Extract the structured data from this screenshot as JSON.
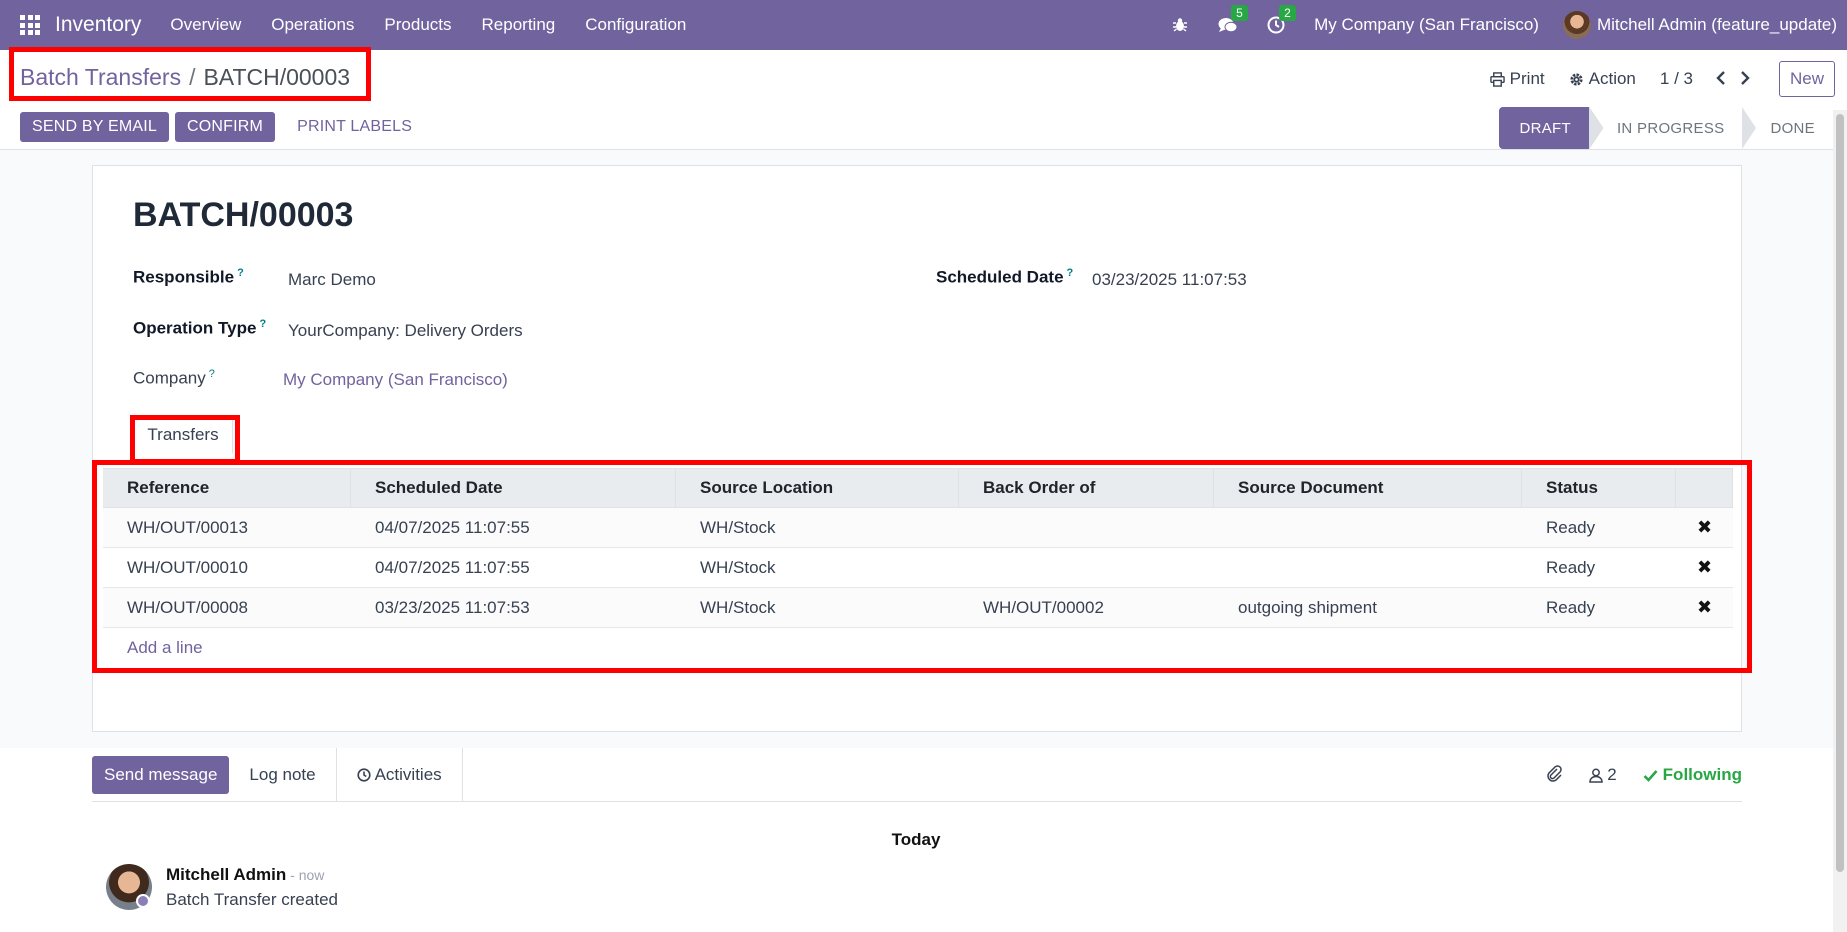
{
  "topnav": {
    "app_name": "Inventory",
    "menu": [
      "Overview",
      "Operations",
      "Products",
      "Reporting",
      "Configuration"
    ],
    "messages_count": "5",
    "activities_count": "2",
    "company": "My Company (San Francisco)",
    "user": "Mitchell Admin (feature_update)"
  },
  "breadcrumb": {
    "parent": "Batch Transfers",
    "separator": "/",
    "current": "BATCH/00003"
  },
  "control": {
    "print_label": "Print",
    "action_label": "Action",
    "pager": "1 / 3",
    "new_label": "New"
  },
  "actions": {
    "send_email": "SEND BY EMAIL",
    "confirm": "CONFIRM",
    "print_labels": "PRINT LABELS"
  },
  "statusbar": [
    "DRAFT",
    "IN PROGRESS",
    "DONE"
  ],
  "form": {
    "title": "BATCH/00003",
    "responsible_label": "Responsible",
    "responsible_value": "Marc Demo",
    "scheduled_label": "Scheduled Date",
    "scheduled_value": "03/23/2025 11:07:53",
    "optype_label": "Operation Type",
    "optype_value": "YourCompany: Delivery Orders",
    "company_label": "Company",
    "company_value": "My Company (San Francisco)",
    "help_mark": "?"
  },
  "tab": "Transfers",
  "table": {
    "headers": [
      "Reference",
      "Scheduled Date",
      "Source Location",
      "Back Order of",
      "Source Document",
      "Status"
    ],
    "rows": [
      {
        "reference": "WH/OUT/00013",
        "date": "04/07/2025 11:07:55",
        "source": "WH/Stock",
        "backorder": "",
        "document": "",
        "status": "Ready"
      },
      {
        "reference": "WH/OUT/00010",
        "date": "04/07/2025 11:07:55",
        "source": "WH/Stock",
        "backorder": "",
        "document": "",
        "status": "Ready"
      },
      {
        "reference": "WH/OUT/00008",
        "date": "03/23/2025 11:07:53",
        "source": "WH/Stock",
        "backorder": "WH/OUT/00002",
        "document": "outgoing shipment",
        "status": "Ready"
      }
    ],
    "add_line": "Add a line",
    "delete_glyph": "✖"
  },
  "chatter": {
    "send_message": "Send message",
    "log_note": "Log note",
    "activities": "Activities",
    "followers_count": "2",
    "following": "Following",
    "date_separator": "Today",
    "author": "Mitchell Admin",
    "time": " - now",
    "body": "Batch Transfer created"
  },
  "colors": {
    "brand": "#71639e",
    "success": "#28a745",
    "highlight": "#ff0000"
  }
}
